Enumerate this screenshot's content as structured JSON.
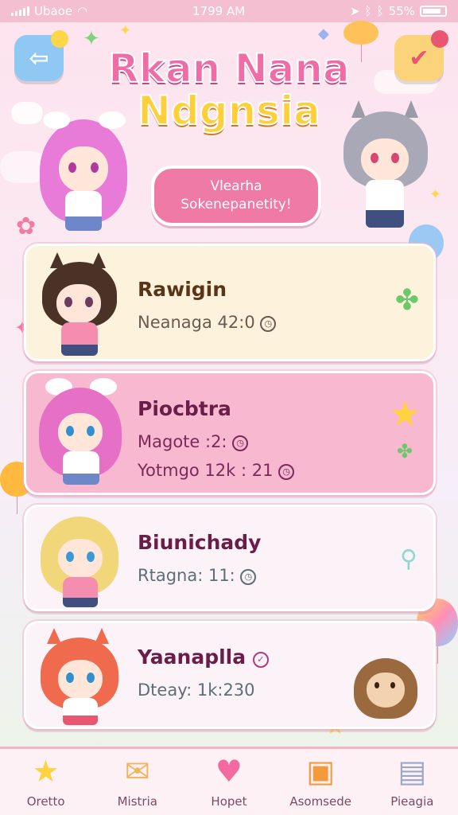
{
  "status_bar": {
    "carrier": "Ubaoe",
    "time": "1799 AM",
    "battery": "55%"
  },
  "header": {
    "title_line1": "Rkan Nana",
    "title_line2": "Ndgnsia",
    "bubble_line1": "Vlearha",
    "bubble_line2": "Sokenepanetity!"
  },
  "cards": [
    {
      "name": "Rawigin",
      "line1": "Neanaga 42:0",
      "line2": ""
    },
    {
      "name": "Piocbtra",
      "line1": "Magote :2:",
      "line2": "Yotmgo 12k : 21"
    },
    {
      "name": "Biunichady",
      "line1": "Rtagna: 11:",
      "line2": ""
    },
    {
      "name": "Yaanaplla",
      "line1": "Dteay: 1k:230",
      "line2": ""
    }
  ],
  "nav": [
    {
      "label": "Oretto",
      "icon": "star-icon"
    },
    {
      "label": "Mistria",
      "icon": "cat-message-icon"
    },
    {
      "label": "Hopet",
      "icon": "heart-icon"
    },
    {
      "label": "Asomsede",
      "icon": "toast-icon"
    },
    {
      "label": "Pieagia",
      "icon": "gift-icon"
    }
  ]
}
